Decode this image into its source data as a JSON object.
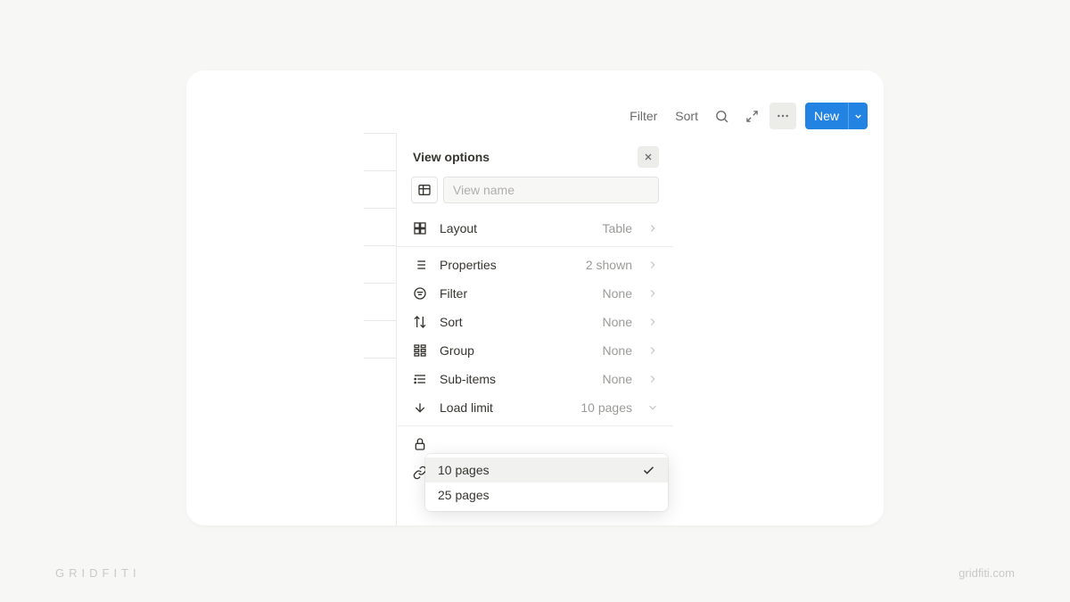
{
  "toolbar": {
    "filter": "Filter",
    "sort": "Sort",
    "new": "New"
  },
  "panel": {
    "title": "View options",
    "view_name_placeholder": "View name",
    "layout": {
      "label": "Layout",
      "value": "Table"
    },
    "properties": {
      "label": "Properties",
      "value": "2 shown"
    },
    "filter": {
      "label": "Filter",
      "value": "None"
    },
    "sort": {
      "label": "Sort",
      "value": "None"
    },
    "group": {
      "label": "Group",
      "value": "None"
    },
    "sub_items": {
      "label": "Sub-items",
      "value": "None"
    },
    "load_limit": {
      "label": "Load limit",
      "value": "10 pages"
    }
  },
  "dropdown": {
    "options": [
      "10 pages",
      "25 pages"
    ]
  },
  "brand": {
    "logo": "GRIDFITI",
    "url": "gridfiti.com"
  }
}
